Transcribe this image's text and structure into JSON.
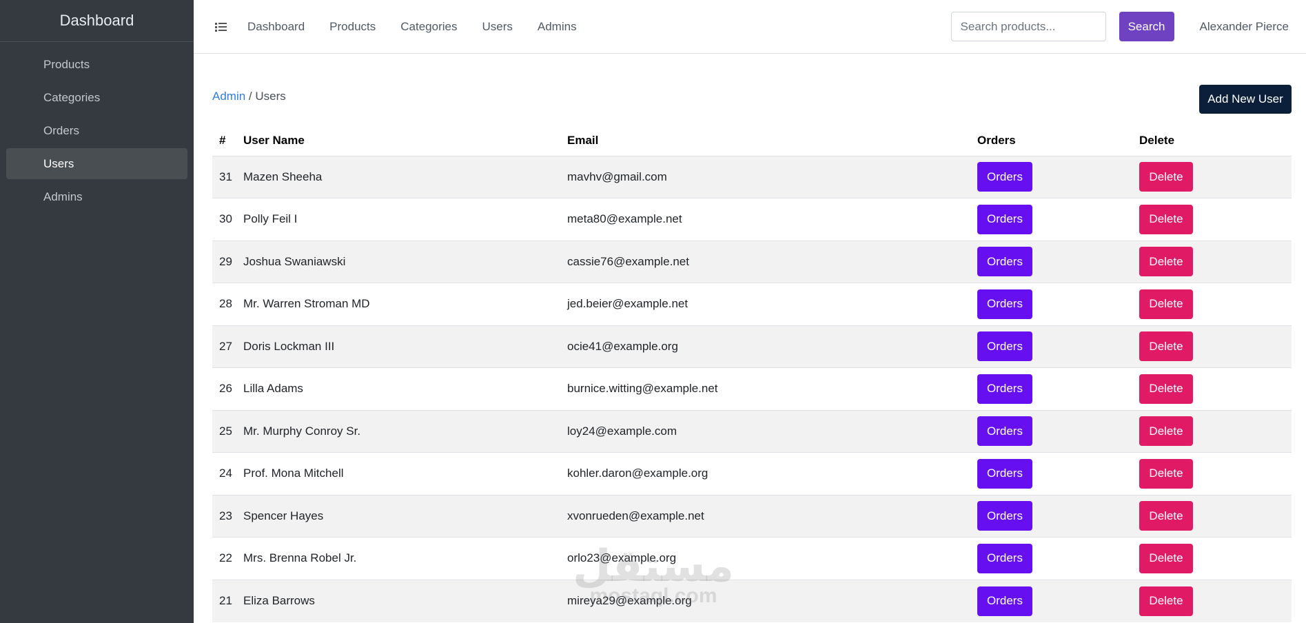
{
  "sidebar": {
    "brand": "Dashboard",
    "items": [
      {
        "label": "Products",
        "active": false
      },
      {
        "label": "Categories",
        "active": false
      },
      {
        "label": "Orders",
        "active": false
      },
      {
        "label": "Users",
        "active": true
      },
      {
        "label": "Admins",
        "active": false
      }
    ]
  },
  "topbar": {
    "menu_icon": "list-icon",
    "links": [
      "Dashboard",
      "Products",
      "Categories",
      "Users",
      "Admins"
    ],
    "search_placeholder": "Search products...",
    "search_value": "",
    "search_button": "Search",
    "user_name": "Alexander Pierce"
  },
  "content": {
    "breadcrumb": {
      "link": "Admin",
      "separator": "/",
      "current": "Users"
    },
    "add_button": "Add New User",
    "table": {
      "headers": [
        "#",
        "User Name",
        "Email",
        "Orders",
        "Delete"
      ],
      "rows": [
        {
          "id": "31",
          "name": "Mazen Sheeha",
          "email": "mavhv@gmail.com"
        },
        {
          "id": "30",
          "name": "Polly Feil I",
          "email": "meta80@example.net"
        },
        {
          "id": "29",
          "name": "Joshua Swaniawski",
          "email": "cassie76@example.net"
        },
        {
          "id": "28",
          "name": "Mr. Warren Stroman MD",
          "email": "jed.beier@example.net"
        },
        {
          "id": "27",
          "name": "Doris Lockman III",
          "email": "ocie41@example.org"
        },
        {
          "id": "26",
          "name": "Lilla Adams",
          "email": "burnice.witting@example.net"
        },
        {
          "id": "25",
          "name": "Mr. Murphy Conroy Sr.",
          "email": "loy24@example.com"
        },
        {
          "id": "24",
          "name": "Prof. Mona Mitchell",
          "email": "kohler.daron@example.org"
        },
        {
          "id": "23",
          "name": "Spencer Hayes",
          "email": "xvonrueden@example.net"
        },
        {
          "id": "22",
          "name": "Mrs. Brenna Robel Jr.",
          "email": "orlo23@example.org"
        },
        {
          "id": "21",
          "name": "Eliza Barrows",
          "email": "mireya29@example.org"
        }
      ],
      "orders_button": "Orders",
      "delete_button": "Delete"
    }
  },
  "watermark": {
    "script_text": "مستقل",
    "latin_text": "mostaql.com"
  },
  "colors": {
    "sidebar_bg": "#343a40",
    "sidebar_active_bg": "#494e53",
    "search_button": "#6f42c1",
    "add_button": "#0b1f3a",
    "orders_button": "#6610f2",
    "delete_button": "#e01a65",
    "breadcrumb_link": "#2f7ddb"
  }
}
